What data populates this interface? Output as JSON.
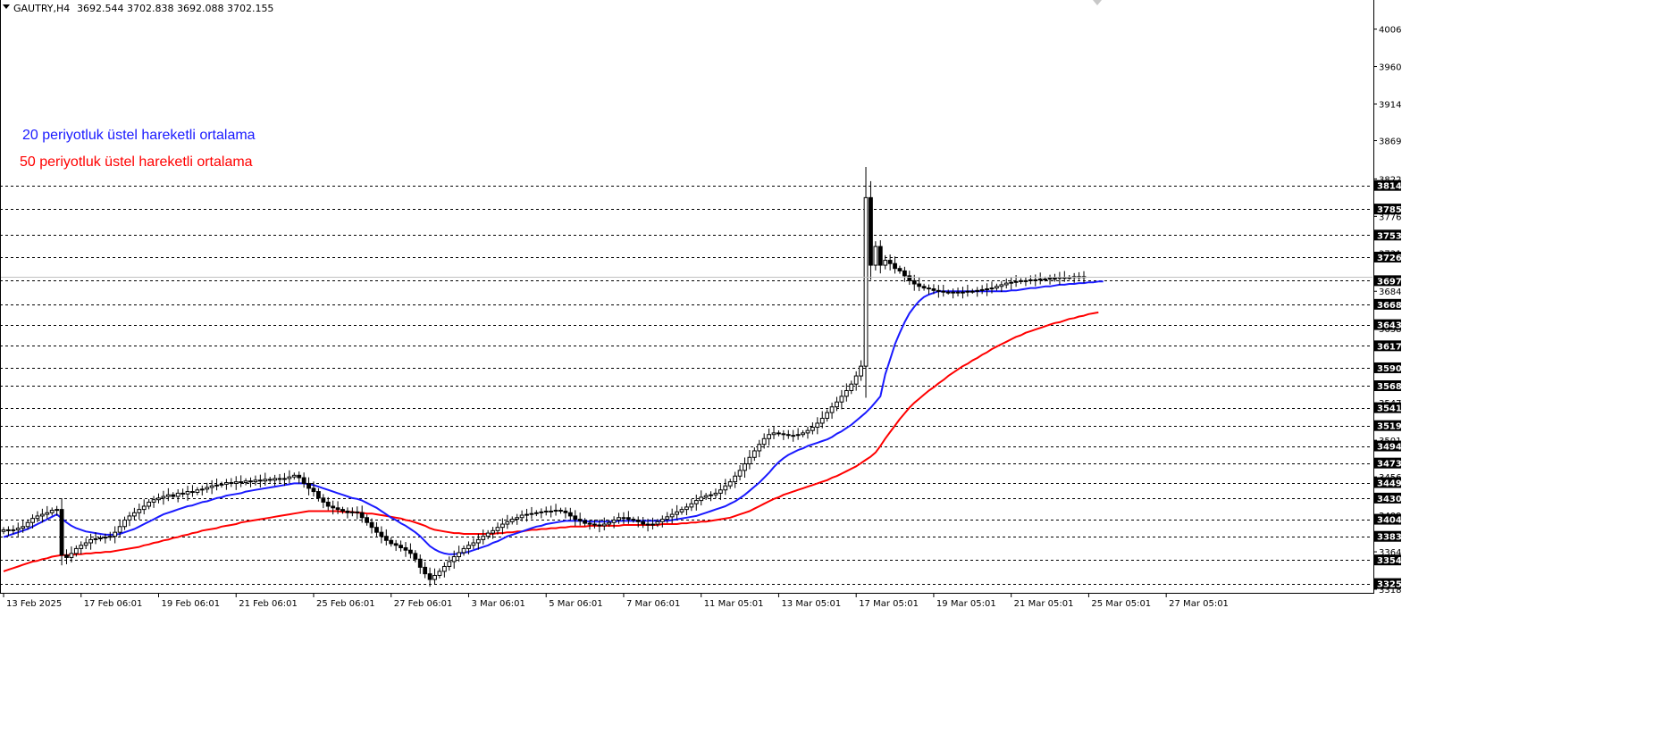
{
  "header": {
    "symbol": "GAUTRY,H4",
    "ohlc": "3692.544 3702.838 3692.088 3702.155"
  },
  "legend": {
    "ema20": "20 periyotluk üstel hareketli ortalama",
    "ema50": "50 periyotluk üstel hareketli ortalama"
  },
  "colors": {
    "ema20": "#1a1aff",
    "ema50": "#ff0000",
    "level_bg": "#000000",
    "grid_dash": "#000000",
    "bull_candle_fill": "#ffffff",
    "bear_candle_fill": "#000000"
  },
  "chart_data": {
    "type": "candlestick",
    "timeframe": "H4",
    "ylim": [
      3318,
      4022
    ],
    "grid": false,
    "y_ticks": [
      "4006",
      "3960",
      "3914",
      "3869",
      "3822",
      "3776",
      "3731",
      "3684",
      "3638",
      "3593",
      "3547",
      "3501",
      "3456",
      "3409",
      "3364",
      "3318"
    ],
    "y_tick_values": [
      4006,
      3960,
      3914,
      3869,
      3822,
      3776,
      3731,
      3684,
      3638,
      3593,
      3547,
      3501,
      3456,
      3409,
      3364,
      3318
    ],
    "levels": [
      3814,
      3785,
      3753,
      3726,
      3697,
      3668,
      3643,
      3617,
      3590,
      3568,
      3541,
      3519,
      3494,
      3473,
      3449,
      3430,
      3404,
      3383,
      3354,
      3325
    ],
    "level_labels": [
      "3814",
      "3785",
      "3753",
      "3726",
      "3697",
      "3668",
      "3643",
      "3617",
      "3590",
      "3568",
      "3541",
      "3519",
      "3494",
      "3473",
      "3449",
      "3430",
      "3404",
      "3383",
      "3354",
      "3325"
    ],
    "current_price": 3702.155,
    "x_labels": [
      "13 Feb 2025",
      "17 Feb 06:01",
      "19 Feb 06:01",
      "21 Feb 06:01",
      "25 Feb 06:01",
      "27 Feb 06:01",
      "3 Mar 06:01",
      "5 Mar 06:01",
      "7 Mar 06:01",
      "11 Mar 05:01",
      "13 Mar 05:01",
      "17 Mar 05:01",
      "19 Mar 05:01",
      "21 Mar 05:01",
      "25 Mar 05:01",
      "27 Mar 05:01"
    ],
    "x_label_index": [
      0,
      16,
      32,
      48,
      64,
      80,
      96,
      112,
      128,
      144,
      160,
      176,
      192,
      208,
      224,
      240
    ],
    "close": [
      3391,
      3390,
      3391,
      3393,
      3395,
      3400,
      3405,
      3408,
      3410,
      3412,
      3415,
      3416,
      3360,
      3357,
      3362,
      3368,
      3372,
      3375,
      3379,
      3380,
      3381,
      3382,
      3383,
      3388,
      3395,
      3403,
      3408,
      3412,
      3416,
      3420,
      3425,
      3428,
      3430,
      3432,
      3434,
      3432,
      3436,
      3435,
      3438,
      3437,
      3440,
      3441,
      3443,
      3445,
      3446,
      3447,
      3449,
      3448,
      3450,
      3449,
      3451,
      3450,
      3452,
      3451,
      3453,
      3452,
      3454,
      3453,
      3454,
      3456,
      3458,
      3455,
      3448,
      3442,
      3438,
      3430,
      3425,
      3420,
      3418,
      3416,
      3414,
      3412,
      3413,
      3412,
      3406,
      3400,
      3394,
      3388,
      3383,
      3378,
      3374,
      3372,
      3369,
      3366,
      3362,
      3355,
      3345,
      3337,
      3330,
      3335,
      3340,
      3346,
      3352,
      3358,
      3363,
      3368,
      3372,
      3375,
      3379,
      3383,
      3387,
      3390,
      3394,
      3398,
      3401,
      3404,
      3406,
      3409,
      3410,
      3411,
      3412,
      3413,
      3414,
      3414,
      3415,
      3414,
      3412,
      3408,
      3404,
      3402,
      3399,
      3398,
      3397,
      3396,
      3398,
      3400,
      3403,
      3406,
      3406,
      3404,
      3403,
      3401,
      3398,
      3397,
      3398,
      3401,
      3404,
      3407,
      3410,
      3413,
      3416,
      3419,
      3423,
      3427,
      3431,
      3433,
      3434,
      3436,
      3440,
      3445,
      3450,
      3457,
      3464,
      3472,
      3480,
      3488,
      3496,
      3503,
      3508,
      3510,
      3509,
      3508,
      3507,
      3507,
      3508,
      3510,
      3513,
      3517,
      3522,
      3528,
      3535,
      3542,
      3548,
      3555,
      3562,
      3570,
      3580,
      3592,
      3799,
      3716,
      3739,
      3716,
      3722,
      3718,
      3712,
      3709,
      3703,
      3697,
      3693,
      3690,
      3688,
      3687,
      3685,
      3684,
      3683,
      3683,
      3682,
      3683,
      3683,
      3684,
      3684,
      3685,
      3686,
      3687,
      3688,
      3690,
      3692,
      3694,
      3695,
      3696,
      3697,
      3697,
      3698,
      3698,
      3699,
      3699,
      3700,
      3700,
      3701,
      3701,
      3701,
      3702,
      3702,
      3702
    ],
    "ema20": [
      3382,
      3384,
      3386,
      3388,
      3390,
      3392,
      3395,
      3398,
      3401,
      3404,
      3407,
      3410,
      3405,
      3400,
      3396,
      3393,
      3391,
      3389,
      3388,
      3387,
      3386,
      3385,
      3385,
      3385,
      3386,
      3388,
      3390,
      3392,
      3395,
      3398,
      3401,
      3404,
      3407,
      3410,
      3412,
      3414,
      3416,
      3418,
      3420,
      3421,
      3423,
      3425,
      3426,
      3428,
      3430,
      3431,
      3433,
      3434,
      3435,
      3436,
      3438,
      3439,
      3440,
      3441,
      3442,
      3443,
      3444,
      3445,
      3446,
      3447,
      3448,
      3448,
      3448,
      3447,
      3446,
      3444,
      3442,
      3440,
      3438,
      3436,
      3434,
      3432,
      3430,
      3429,
      3427,
      3424,
      3421,
      3418,
      3414,
      3410,
      3406,
      3403,
      3399,
      3396,
      3392,
      3388,
      3383,
      3377,
      3371,
      3367,
      3364,
      3362,
      3361,
      3361,
      3362,
      3363,
      3364,
      3366,
      3368,
      3370,
      3372,
      3375,
      3377,
      3380,
      3383,
      3385,
      3387,
      3389,
      3391,
      3393,
      3395,
      3396,
      3398,
      3399,
      3400,
      3401,
      3402,
      3402,
      3402,
      3402,
      3402,
      3401,
      3401,
      3401,
      3401,
      3401,
      3401,
      3402,
      3402,
      3402,
      3402,
      3402,
      3402,
      3402,
      3402,
      3402,
      3402,
      3402,
      3403,
      3404,
      3405,
      3406,
      3407,
      3408,
      3410,
      3412,
      3414,
      3416,
      3418,
      3420,
      3423,
      3426,
      3430,
      3434,
      3439,
      3444,
      3449,
      3455,
      3461,
      3468,
      3474,
      3479,
      3483,
      3486,
      3489,
      3491,
      3494,
      3496,
      3498,
      3500,
      3502,
      3505,
      3509,
      3512,
      3516,
      3520,
      3525,
      3530,
      3535,
      3541,
      3548,
      3555,
      3582,
      3600,
      3619,
      3633,
      3646,
      3657,
      3665,
      3672,
      3677,
      3680,
      3682,
      3684,
      3684,
      3684,
      3684,
      3684,
      3684,
      3684,
      3684,
      3684,
      3684,
      3684,
      3684,
      3684,
      3684,
      3684,
      3685,
      3685,
      3686,
      3687,
      3688,
      3688,
      3689,
      3690,
      3690,
      3691,
      3692,
      3692,
      3693,
      3693,
      3694,
      3694,
      3695,
      3695,
      3696,
      3696
    ],
    "ema50": [
      3340,
      3342,
      3344,
      3346,
      3348,
      3350,
      3352,
      3353,
      3355,
      3356,
      3358,
      3359,
      3360,
      3360,
      3360,
      3361,
      3361,
      3362,
      3362,
      3363,
      3363,
      3364,
      3364,
      3365,
      3366,
      3367,
      3368,
      3369,
      3370,
      3372,
      3373,
      3375,
      3376,
      3378,
      3379,
      3381,
      3382,
      3384,
      3385,
      3387,
      3388,
      3390,
      3391,
      3392,
      3393,
      3395,
      3396,
      3397,
      3398,
      3400,
      3401,
      3402,
      3403,
      3404,
      3405,
      3406,
      3407,
      3408,
      3409,
      3410,
      3411,
      3412,
      3413,
      3414,
      3414,
      3414,
      3414,
      3414,
      3414,
      3414,
      3413,
      3413,
      3413,
      3412,
      3412,
      3411,
      3411,
      3410,
      3409,
      3408,
      3407,
      3406,
      3405,
      3403,
      3402,
      3400,
      3398,
      3396,
      3393,
      3391,
      3390,
      3389,
      3388,
      3387,
      3387,
      3386,
      3386,
      3386,
      3386,
      3386,
      3386,
      3386,
      3387,
      3387,
      3388,
      3388,
      3389,
      3389,
      3390,
      3391,
      3391,
      3392,
      3392,
      3393,
      3393,
      3394,
      3394,
      3395,
      3395,
      3395,
      3395,
      3396,
      3396,
      3396,
      3396,
      3396,
      3396,
      3396,
      3397,
      3397,
      3397,
      3397,
      3397,
      3397,
      3397,
      3397,
      3398,
      3398,
      3398,
      3398,
      3399,
      3399,
      3400,
      3400,
      3401,
      3401,
      3402,
      3403,
      3404,
      3405,
      3406,
      3408,
      3410,
      3412,
      3414,
      3417,
      3420,
      3423,
      3426,
      3429,
      3431,
      3434,
      3436,
      3438,
      3440,
      3442,
      3444,
      3446,
      3448,
      3450,
      3452,
      3455,
      3457,
      3460,
      3463,
      3466,
      3469,
      3473,
      3477,
      3481,
      3486,
      3494,
      3503,
      3511,
      3519,
      3527,
      3534,
      3541,
      3547,
      3552,
      3557,
      3562,
      3566,
      3571,
      3575,
      3580,
      3584,
      3588,
      3592,
      3595,
      3599,
      3602,
      3606,
      3609,
      3613,
      3616,
      3619,
      3622,
      3625,
      3628,
      3630,
      3633,
      3635,
      3637,
      3639,
      3641,
      3643,
      3645,
      3646,
      3648,
      3650,
      3651,
      3653,
      3654,
      3656,
      3657,
      3658
    ]
  }
}
